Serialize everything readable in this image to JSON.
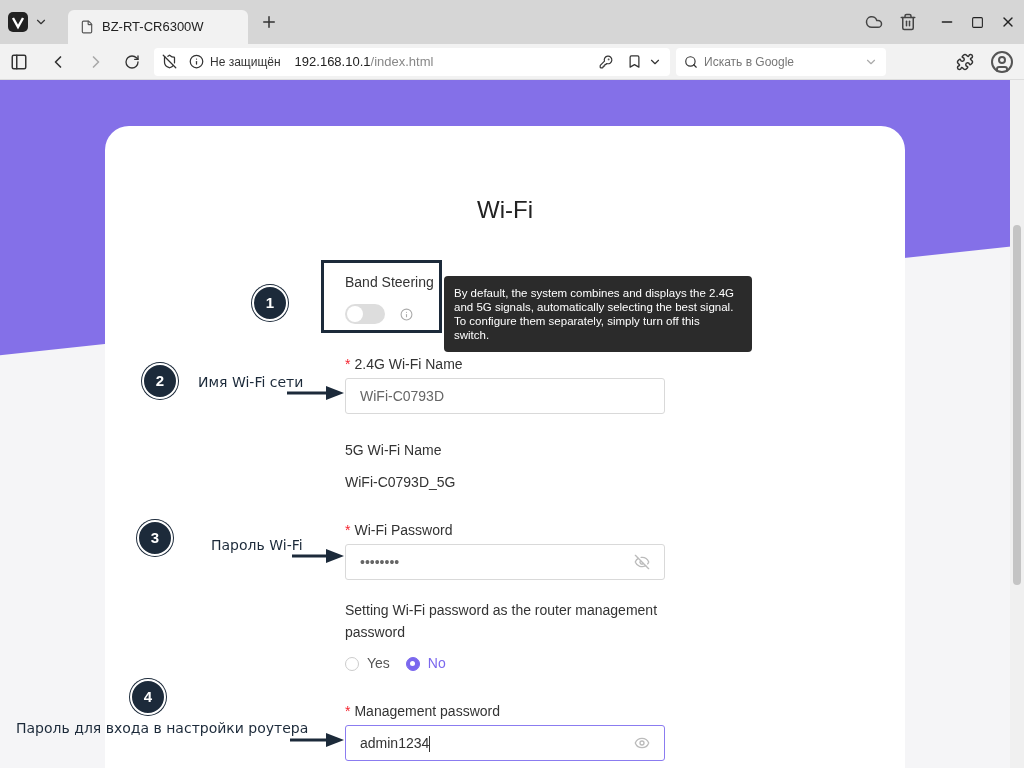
{
  "browser": {
    "tab_title": "BZ-RT-CR6300W",
    "security": "Не защищён",
    "url_host": "192.168.10.1",
    "url_path": "/index.html",
    "search_placeholder": "Искать в Google"
  },
  "page": {
    "title": "Wi-Fi",
    "band_steering": {
      "label": "Band Steering",
      "on": false,
      "tooltip": "By default, the system combines and displays the 2.4G and 5G signals, automatically selecting the best signal. To configure them separately, simply turn off this switch."
    },
    "fields": [
      {
        "kind": "input",
        "required_mark": "*",
        "label": "2.4G Wi-Fi Name",
        "value": "WiFi-C0793D",
        "focused": false
      },
      {
        "kind": "static",
        "label": "5G Wi-Fi Name",
        "value": "WiFi-C0793D_5G"
      },
      {
        "kind": "password",
        "required_mark": "*",
        "label": "Wi-Fi Password",
        "value": "••••••••",
        "focused": false,
        "revealed": false
      },
      {
        "kind": "radio",
        "label": "Setting Wi-Fi password as the router management password",
        "options": [
          {
            "label": "Yes",
            "selected": false
          },
          {
            "label": "No",
            "selected": true
          }
        ]
      },
      {
        "kind": "password",
        "required_mark": "*",
        "label": "Management password",
        "value": "admin1234",
        "focused": true,
        "revealed": true
      }
    ]
  },
  "annotations": [
    {
      "number": "1"
    },
    {
      "number": "2",
      "label": "Имя Wi-Fi сети"
    },
    {
      "number": "3",
      "label": "Пароль Wi-Fi"
    },
    {
      "number": "4",
      "label": "Пароль для входа в настройки роутера"
    }
  ]
}
